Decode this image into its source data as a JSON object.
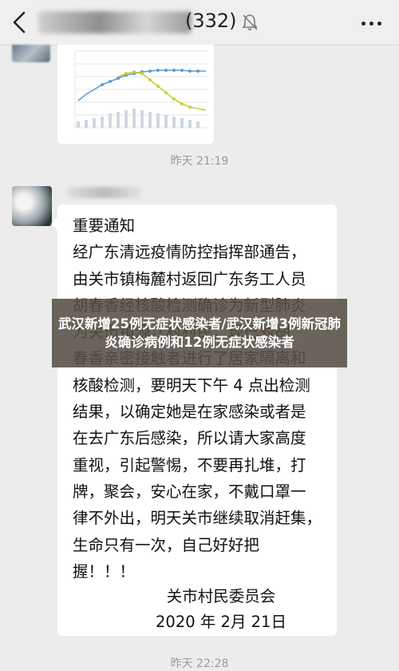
{
  "header": {
    "back_icon": "chevron-left-icon",
    "title_count": "(332)",
    "mute_icon": "bell-off-icon",
    "more_icon": "more-dots-icon"
  },
  "timestamps": {
    "first": "昨天 21:19",
    "second": "昨天 22:28"
  },
  "message": {
    "lines": "重要通知\n经广东清远疫情防控指挥部通告，\n由关市镇梅麓村返回广东务工人员\n胡春香经核酸检测确诊为新型肺炎\n为关市镇源江村村民，现已对胡\n春香亲密接触者进行了居家隔离和\n核酸检测，要明天下午 4 点出检测\n结果，以确定她是在家感染或者是\n在去广东后感染，所以请大家高度\n重视，引起警惕，不要再扎堆，打\n牌，聚会，安心在家，不戴口罩一\n律不外出，明天关市继续取消赶集，\n生命只有一次，自己好好把\n握！！！",
    "signer": "关市村民委员会",
    "date": "2020 年 2月 21日"
  },
  "banner": {
    "text": "武汉新增25例无症状感染者/武汉新增3例新冠肺炎确诊病例和12例无症状感染者"
  },
  "colors": {
    "background": "#ececec",
    "bubble": "#ffffff",
    "banner": "#554e46",
    "chart_line": "#5b9bd5",
    "chart_line2": "#c9cf3a"
  }
}
